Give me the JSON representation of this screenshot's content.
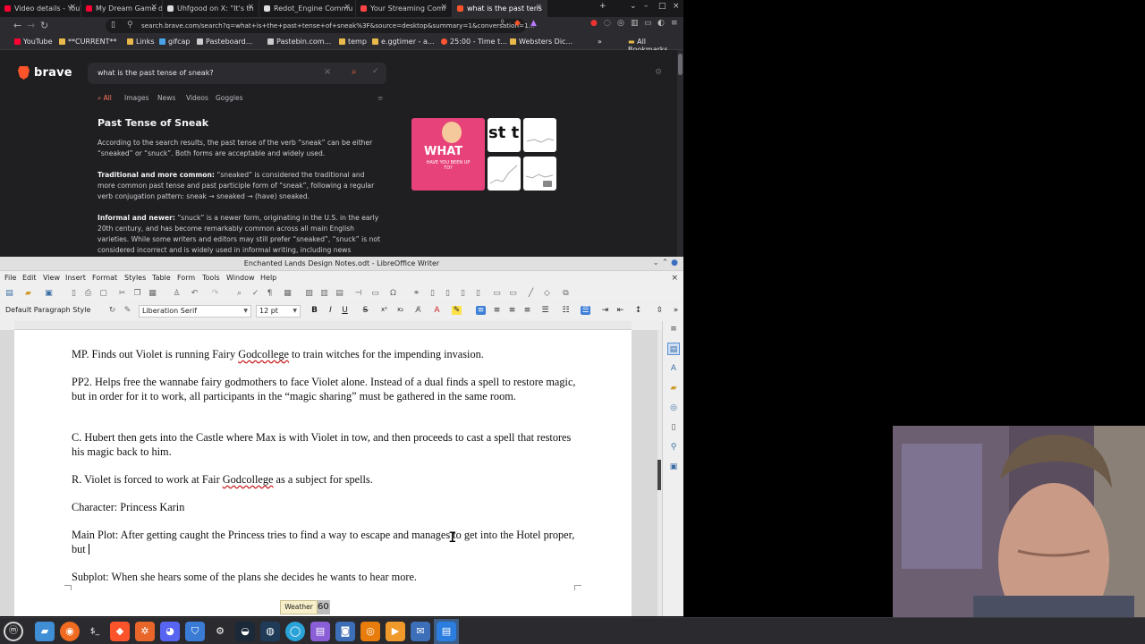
{
  "browser": {
    "tabs": [
      {
        "title": "Video details - YouTub",
        "color": "#ff0033"
      },
      {
        "title": "My Dream Game devl",
        "color": "#3aa0ff"
      },
      {
        "title": "Uhfgood on X: \"It's th",
        "color": "#ffffff"
      },
      {
        "title": "Redot_Engine Commu",
        "color": "#ffffff"
      },
      {
        "title": "Your Streaming Comr",
        "color": "#ff4444"
      },
      {
        "title": "what is the past tens",
        "color": "#fb542b"
      }
    ],
    "url": "search.brave.com/search?q=what+is+the+past+tense+of+sneak%3F&source=desktop&summary=1&conversation=1...",
    "bookmarks": [
      {
        "label": "YouTube",
        "color": "#ff0033"
      },
      {
        "label": "**CURRENT**",
        "color": "#e8b94a"
      },
      {
        "label": "Links",
        "color": "#e8b94a"
      },
      {
        "label": "gifcap",
        "color": "#4aa3e8"
      },
      {
        "label": "Pasteboard...",
        "color": "#cccccc"
      },
      {
        "label": "Pastebin.com...",
        "color": "#cccccc"
      },
      {
        "label": "temp",
        "color": "#e8b94a"
      },
      {
        "label": "e.ggtimer - a...",
        "color": "#e8b94a"
      },
      {
        "label": "25:00 - Time t...",
        "color": "#ff5533"
      },
      {
        "label": "Websters Dic...",
        "color": "#e8b94a"
      }
    ],
    "all_bookmarks": "All Bookmarks",
    "brave_name": "brave",
    "search_query": "what is the past tense of sneak?",
    "search_tabs": [
      "All",
      "Images",
      "News",
      "Videos",
      "Goggles"
    ],
    "result": {
      "title": "Past Tense of Sneak",
      "p1": "According to the search results, the past tense of the verb “sneak” can be either “sneaked” or “snuck”. Both forms are acceptable and widely used.",
      "p2_bold": "Traditional and more common:",
      "p2": " “sneaked” is considered the traditional and more common past tense and past participle form of “sneak”, following a regular verb conjugation pattern: sneak → sneaked → (have) sneaked.",
      "p3_bold": "Informal and newer:",
      "p3": " “snuck” is a newer form, originating in the U.S. in the early 20th century, and has become remarkably common across all main English varieties. While some writers and editors may still prefer “sneaked”, “snuck” is not considered incorrect and is widely used in informal writing, including news"
    },
    "thumb_main_word": "WHAT",
    "thumb_main_sub": "HAVE YOU BEEN UP TO?",
    "thumb_text": "st t"
  },
  "writer": {
    "title": "Enchanted Lands Design Notes.odt - LibreOffice Writer",
    "menu": [
      "File",
      "Edit",
      "View",
      "Insert",
      "Format",
      "Styles",
      "Table",
      "Form",
      "Tools",
      "Window",
      "Help"
    ],
    "paragraph_style": "Default Paragraph Style",
    "font_name": "Liberation Serif",
    "font_size": "12 pt",
    "doc": [
      {
        "pre": "MP.  Finds out Violet is running Fairy ",
        "sq": "Godcollege",
        "post": " to train witches for the impending invasion."
      },
      {
        "pre": "PP2.  Helps free the wannabe fairy godmothers to face Violet alone. Instead of a dual finds a spell to restore magic, but in order for it to work, all participants in the “magic sharing” must be gathered in the same room.",
        "sq": "",
        "post": ""
      },
      {
        "pre": "C.  Hubert then gets into the Castle where Max is with Violet in tow, and then proceeds to cast a spell that restores his magic back to him.",
        "sq": "",
        "post": ""
      },
      {
        "pre": "R.  Violet is forced to work at Fair ",
        "sq": "Godcollege",
        "post": " as a subject for spells."
      },
      {
        "pre": "Character: Princess Karin",
        "sq": "",
        "post": ""
      },
      {
        "pre": "Main Plot: After getting caught the Princess tries to find a way to escape and manages to get into the Hotel proper, but ",
        "sq": "",
        "post": ""
      },
      {
        "pre": "Subplot:  When she hears some of the plans she decides he wants to hear more.",
        "sq": "",
        "post": ""
      }
    ]
  },
  "desktop": {
    "weather": "Weather",
    "tooltip_peek": "60"
  }
}
